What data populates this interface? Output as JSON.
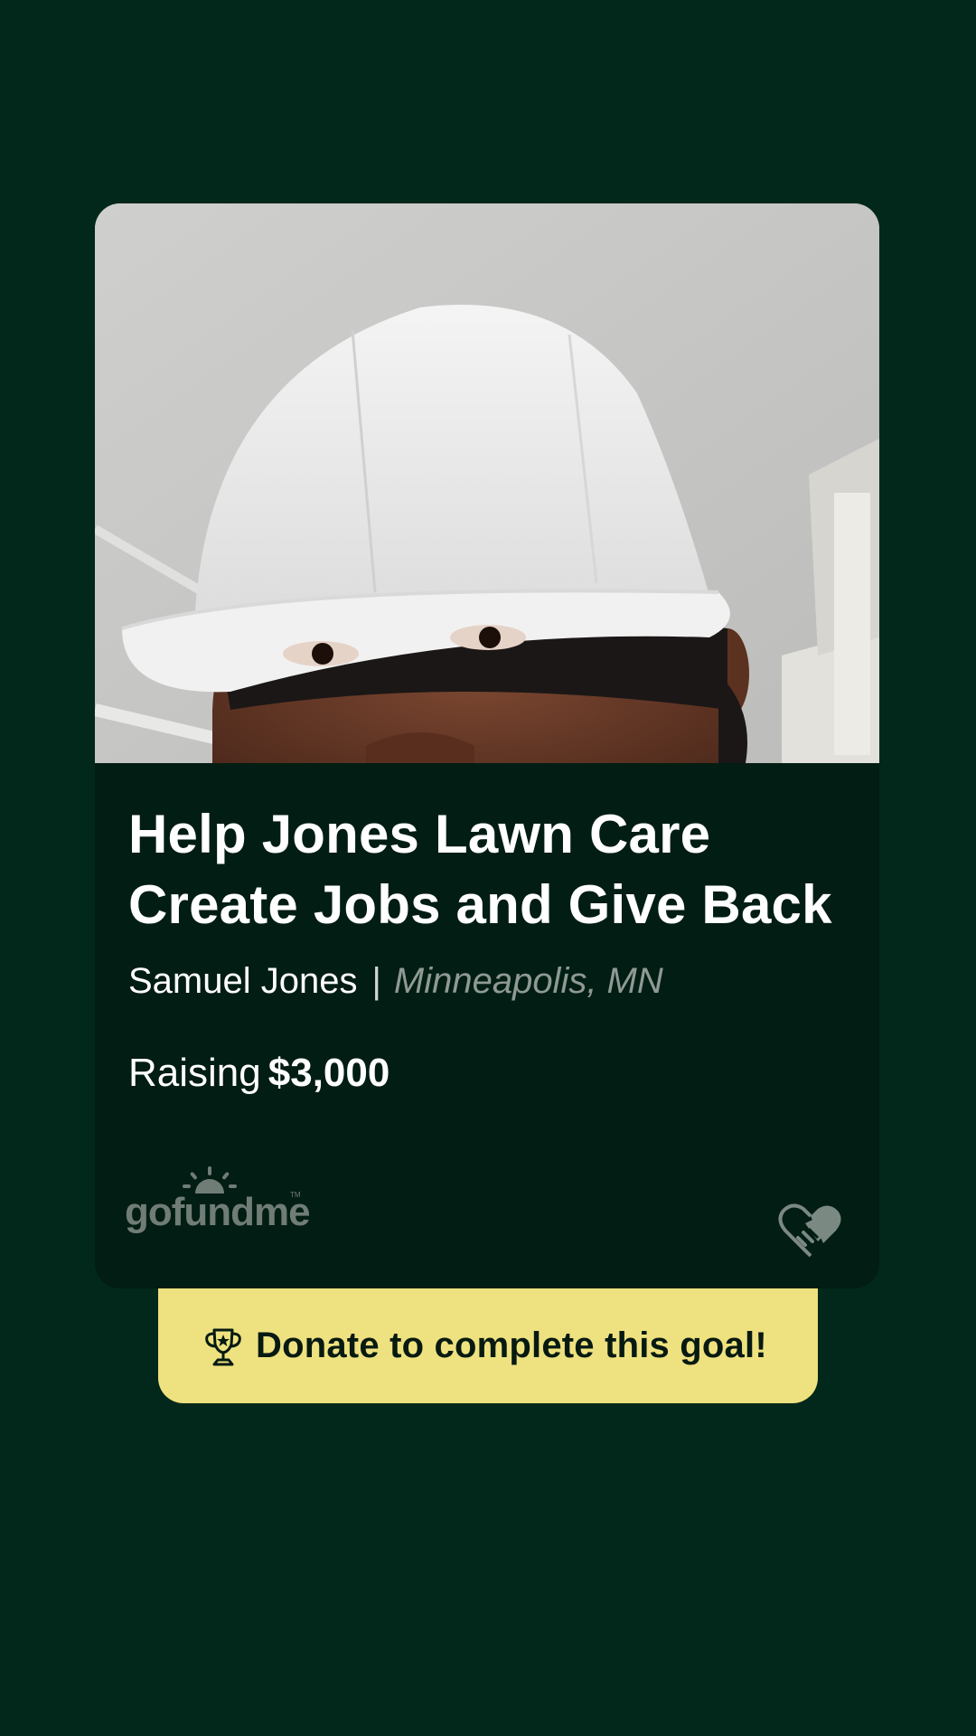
{
  "campaign": {
    "title_line1": "Help Jones Lawn Care",
    "title_line2": "Create Jobs and Give Back",
    "organizer": "Samuel Jones",
    "separator": "|",
    "location": "Minneapolis, MN",
    "raising_label": "Raising",
    "goal_amount": "$3,000"
  },
  "brand": {
    "name": "gofundme",
    "trademark": "TM"
  },
  "cta": {
    "label": "Donate to complete this goal!",
    "icon": "trophy-icon"
  },
  "icons": {
    "badge": "heart-handshake-icon",
    "brand_mark": "sun-rays-icon"
  },
  "colors": {
    "background": "#01281a",
    "card": "#021d13",
    "cta_background": "#eee17f",
    "muted_text": "#8e9a94"
  }
}
